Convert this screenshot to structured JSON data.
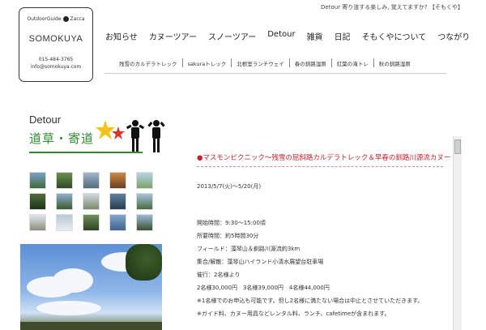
{
  "header": {
    "logo": {
      "top_left": "OutdoorGuide",
      "top_right": "Zacca",
      "name": "SOMOKUYA",
      "phone": "015-484-3765",
      "email": "info@somokuya.com"
    },
    "tagline": "Detour  寄り道する楽しみ, 覚えてますか? 【そもくや】",
    "main_nav": [
      "お知らせ",
      "カヌーツアー",
      "スノーツアー",
      "Detour",
      "雑貨",
      "日記",
      "そもくやについて",
      "つながり"
    ],
    "sub_nav": [
      "残雪のカルデラトレック",
      "sakuraトレック",
      "北根室ランチウェイ",
      "春の釧路湿原",
      "紅葉の滝トレ",
      "秋の釧路湿原"
    ]
  },
  "sidebar": {
    "banner_title": "Detour",
    "banner_subtitle": "道草・寄道"
  },
  "article": {
    "title": "●マスモンピクニック～残雪の屈斜路カルデラトレック＆早春の釧路川源流カヌー",
    "date_range": "2013/5/7(火)～5/20(月)",
    "lines": [
      "開始時間：9:30～15:00頃",
      "所要時間：約5時間30分",
      "フィールド：藻琴山＆釧路川源流約3km",
      "集合/解散：藻琴山ハイランド小清水展望台駐車場",
      "催行：2名様より",
      "2名様30,000円　3名様39,000円　4名様44,000円",
      "※1名様でのお申込も可能です。但し2名様に満たない場合は中止とさせていただきます。",
      "※ガイド料、カヌー用具などレンタル料、ランチ、cafetimeが含まれます。"
    ]
  },
  "colors": {
    "accent_red": "#c8202a",
    "accent_green": "#2e8b2e"
  }
}
